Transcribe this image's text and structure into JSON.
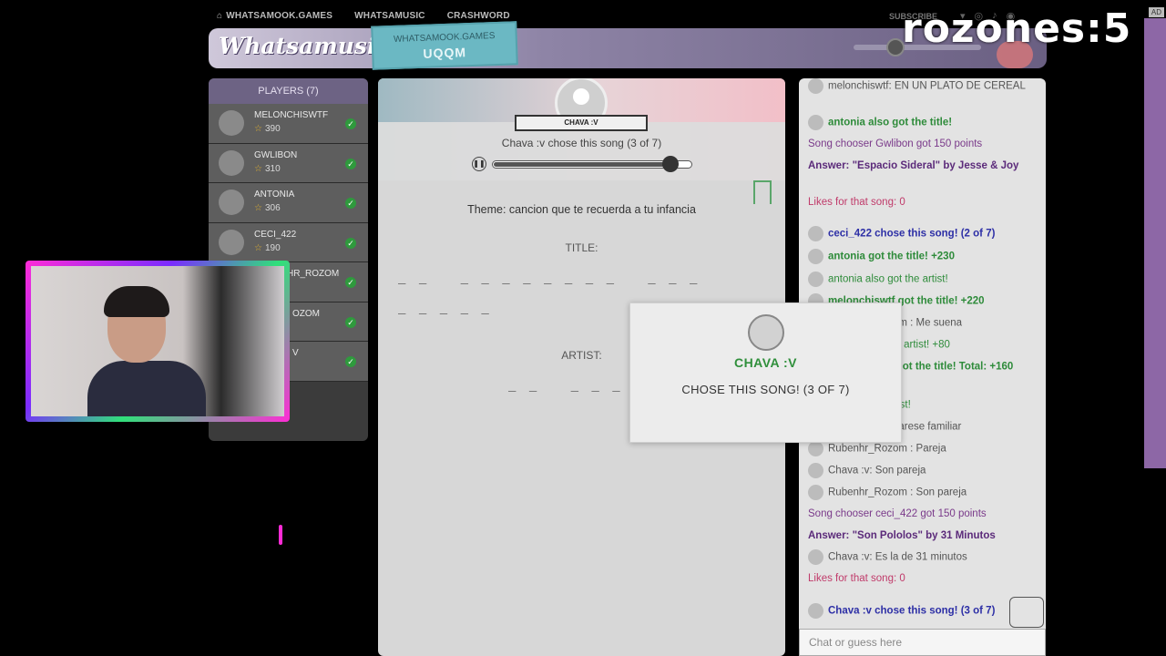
{
  "topnav": {
    "items": [
      "WHATSAMOOK.GAMES",
      "WHATSAMUSIC",
      "CRASHWORD"
    ],
    "subscribe": "SUBSCRIBE",
    "ad": "AD"
  },
  "overlay": {
    "text": "rozones:5"
  },
  "header": {
    "logo": "Whatsamusic",
    "badge_line1": "WHATSAMOOK.GAMES",
    "badge_line2": "UQQM"
  },
  "players": {
    "heading": "PLAYERS (7)",
    "list": [
      {
        "name": "MELONCHISWTF",
        "points": "390"
      },
      {
        "name": "GWLIBON",
        "points": "310"
      },
      {
        "name": "ANTONIA",
        "points": "306"
      },
      {
        "name": "CECI_422",
        "points": "190"
      },
      {
        "name": "HR_ROZOM",
        "points": ""
      },
      {
        "name": "OZOM",
        "points": ""
      },
      {
        "name": "V",
        "points": ""
      }
    ]
  },
  "game": {
    "chooser_ribbon": "CHAVA :V",
    "chose_line": "Chava :v chose this song (3 of 7)",
    "theme": "Theme: cancion que te recuerda a tu infancia",
    "title_label": "TITLE:",
    "artist_label": "ARTIST:",
    "title_blanks_1": "_ _   _ _ _ _ _ _ _ _   _ _ _",
    "title_blanks_2": "_ _ _ _ _",
    "artist_blanks": "_ _   _ _ _ _ _",
    "audio_progress": 0.9
  },
  "popup": {
    "name": "CHAVA :V",
    "message": "CHOSE THIS SONG! (3 OF 7)"
  },
  "chat": {
    "messages": [
      {
        "text": "melonchiswtf: EN UN PLATO DE CEREAL",
        "style": "c-gray",
        "avatar": true
      },
      {
        "text": "antonia also got the title!",
        "style": "c-green",
        "avatar": true
      },
      {
        "text": "Song chooser Gwlibon got 150 points",
        "style": "c-purple",
        "avatar": false
      },
      {
        "text": "Answer: \"Espacio Sideral\" by Jesse & Joy",
        "style": "c-purple-b",
        "avatar": false
      },
      {
        "text": "Likes for that song: 0",
        "style": "c-pink",
        "avatar": false
      },
      {
        "text": "ceci_422 chose this song! (2 of 7)",
        "style": "c-blue",
        "avatar": true
      },
      {
        "text": "antonia got the title! +230",
        "style": "c-green",
        "avatar": true
      },
      {
        "text": "antonia also got the artist!",
        "style": "c-green-n",
        "avatar": true
      },
      {
        "text": "melonchiswtf got the title! +220",
        "style": "c-green",
        "avatar": true
      },
      {
        "text": "Rubenhr_Rozom : Me suena",
        "style": "c-gray",
        "avatar": true
      },
      {
        "text": "Gwlibon got the artist! +80",
        "style": "c-green-n",
        "avatar": true
      },
      {
        "text": "Gwlibon also got the title! Total: +160",
        "style": "c-green",
        "avatar": true
      },
      {
        "text": "also got the artist!",
        "style": "c-green-n",
        "avatar": true
      },
      {
        "text": "Chava :v: Me paresе familiar",
        "style": "c-gray",
        "avatar": true
      },
      {
        "text": "Rubenhr_Rozom : Pareja",
        "style": "c-gray",
        "avatar": true
      },
      {
        "text": "Chava :v: Son pareja",
        "style": "c-gray",
        "avatar": true
      },
      {
        "text": "Rubenhr_Rozom : Son pareja",
        "style": "c-gray",
        "avatar": true
      },
      {
        "text": "Song chooser ceci_422 got 150 points",
        "style": "c-purple",
        "avatar": false
      },
      {
        "text": "Answer: \"Son Pololos\" by 31 Minutos",
        "style": "c-purple-b",
        "avatar": false
      },
      {
        "text": "Chava :v: Es la de 31 minutos",
        "style": "c-gray",
        "avatar": true
      },
      {
        "text": "Likes for that song: 0",
        "style": "c-pink",
        "avatar": false
      },
      {
        "text": "Chava :v chose this song! (3 of 7)",
        "style": "c-blue",
        "avatar": true
      }
    ],
    "input_placeholder": "Chat or guess here"
  }
}
